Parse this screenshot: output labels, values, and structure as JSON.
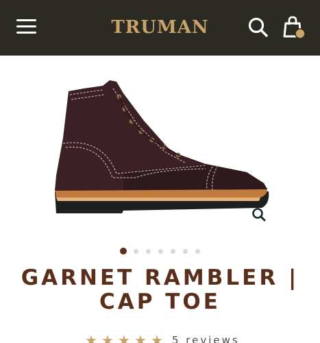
{
  "header": {
    "brand": "TRUMAN",
    "menu_icon": "hamburger-menu-icon",
    "search_icon": "search-icon",
    "cart_icon": "shopping-bag-icon",
    "background_color": "#2b2b24",
    "logo_color": "#c8a46a"
  },
  "gallery": {
    "image_description": "boot-image",
    "zoom_icon": "magnifier-icon",
    "slides_total": 7,
    "active_slide": 1
  },
  "product": {
    "title": "GARNET RAMBLER | CAP TOE",
    "title_color": "#5a2e1b",
    "rating": 5,
    "star_icon": "star-icon",
    "reviews_label": "5 reviews"
  }
}
